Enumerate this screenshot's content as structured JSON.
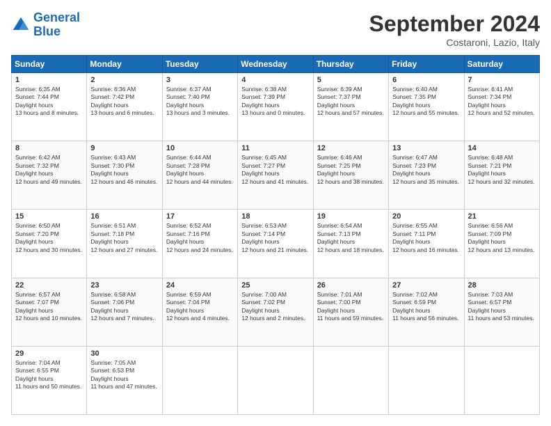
{
  "header": {
    "logo_line1": "General",
    "logo_line2": "Blue",
    "month": "September 2024",
    "location": "Costaroni, Lazio, Italy"
  },
  "weekdays": [
    "Sunday",
    "Monday",
    "Tuesday",
    "Wednesday",
    "Thursday",
    "Friday",
    "Saturday"
  ],
  "weeks": [
    [
      {
        "day": "1",
        "sunrise": "6:35 AM",
        "sunset": "7:44 PM",
        "daylight": "13 hours and 8 minutes."
      },
      {
        "day": "2",
        "sunrise": "6:36 AM",
        "sunset": "7:42 PM",
        "daylight": "13 hours and 6 minutes."
      },
      {
        "day": "3",
        "sunrise": "6:37 AM",
        "sunset": "7:40 PM",
        "daylight": "13 hours and 3 minutes."
      },
      {
        "day": "4",
        "sunrise": "6:38 AM",
        "sunset": "7:39 PM",
        "daylight": "13 hours and 0 minutes."
      },
      {
        "day": "5",
        "sunrise": "6:39 AM",
        "sunset": "7:37 PM",
        "daylight": "12 hours and 57 minutes."
      },
      {
        "day": "6",
        "sunrise": "6:40 AM",
        "sunset": "7:35 PM",
        "daylight": "12 hours and 55 minutes."
      },
      {
        "day": "7",
        "sunrise": "6:41 AM",
        "sunset": "7:34 PM",
        "daylight": "12 hours and 52 minutes."
      }
    ],
    [
      {
        "day": "8",
        "sunrise": "6:42 AM",
        "sunset": "7:32 PM",
        "daylight": "12 hours and 49 minutes."
      },
      {
        "day": "9",
        "sunrise": "6:43 AM",
        "sunset": "7:30 PM",
        "daylight": "12 hours and 46 minutes."
      },
      {
        "day": "10",
        "sunrise": "6:44 AM",
        "sunset": "7:28 PM",
        "daylight": "12 hours and 44 minutes."
      },
      {
        "day": "11",
        "sunrise": "6:45 AM",
        "sunset": "7:27 PM",
        "daylight": "12 hours and 41 minutes."
      },
      {
        "day": "12",
        "sunrise": "6:46 AM",
        "sunset": "7:25 PM",
        "daylight": "12 hours and 38 minutes."
      },
      {
        "day": "13",
        "sunrise": "6:47 AM",
        "sunset": "7:23 PM",
        "daylight": "12 hours and 35 minutes."
      },
      {
        "day": "14",
        "sunrise": "6:48 AM",
        "sunset": "7:21 PM",
        "daylight": "12 hours and 32 minutes."
      }
    ],
    [
      {
        "day": "15",
        "sunrise": "6:50 AM",
        "sunset": "7:20 PM",
        "daylight": "12 hours and 30 minutes."
      },
      {
        "day": "16",
        "sunrise": "6:51 AM",
        "sunset": "7:18 PM",
        "daylight": "12 hours and 27 minutes."
      },
      {
        "day": "17",
        "sunrise": "6:52 AM",
        "sunset": "7:16 PM",
        "daylight": "12 hours and 24 minutes."
      },
      {
        "day": "18",
        "sunrise": "6:53 AM",
        "sunset": "7:14 PM",
        "daylight": "12 hours and 21 minutes."
      },
      {
        "day": "19",
        "sunrise": "6:54 AM",
        "sunset": "7:13 PM",
        "daylight": "12 hours and 18 minutes."
      },
      {
        "day": "20",
        "sunrise": "6:55 AM",
        "sunset": "7:11 PM",
        "daylight": "12 hours and 16 minutes."
      },
      {
        "day": "21",
        "sunrise": "6:56 AM",
        "sunset": "7:09 PM",
        "daylight": "12 hours and 13 minutes."
      }
    ],
    [
      {
        "day": "22",
        "sunrise": "6:57 AM",
        "sunset": "7:07 PM",
        "daylight": "12 hours and 10 minutes."
      },
      {
        "day": "23",
        "sunrise": "6:58 AM",
        "sunset": "7:06 PM",
        "daylight": "12 hours and 7 minutes."
      },
      {
        "day": "24",
        "sunrise": "6:59 AM",
        "sunset": "7:04 PM",
        "daylight": "12 hours and 4 minutes."
      },
      {
        "day": "25",
        "sunrise": "7:00 AM",
        "sunset": "7:02 PM",
        "daylight": "12 hours and 2 minutes."
      },
      {
        "day": "26",
        "sunrise": "7:01 AM",
        "sunset": "7:00 PM",
        "daylight": "11 hours and 59 minutes."
      },
      {
        "day": "27",
        "sunrise": "7:02 AM",
        "sunset": "6:59 PM",
        "daylight": "11 hours and 56 minutes."
      },
      {
        "day": "28",
        "sunrise": "7:03 AM",
        "sunset": "6:57 PM",
        "daylight": "11 hours and 53 minutes."
      }
    ],
    [
      {
        "day": "29",
        "sunrise": "7:04 AM",
        "sunset": "6:55 PM",
        "daylight": "11 hours and 50 minutes."
      },
      {
        "day": "30",
        "sunrise": "7:05 AM",
        "sunset": "6:53 PM",
        "daylight": "11 hours and 47 minutes."
      },
      null,
      null,
      null,
      null,
      null
    ]
  ]
}
